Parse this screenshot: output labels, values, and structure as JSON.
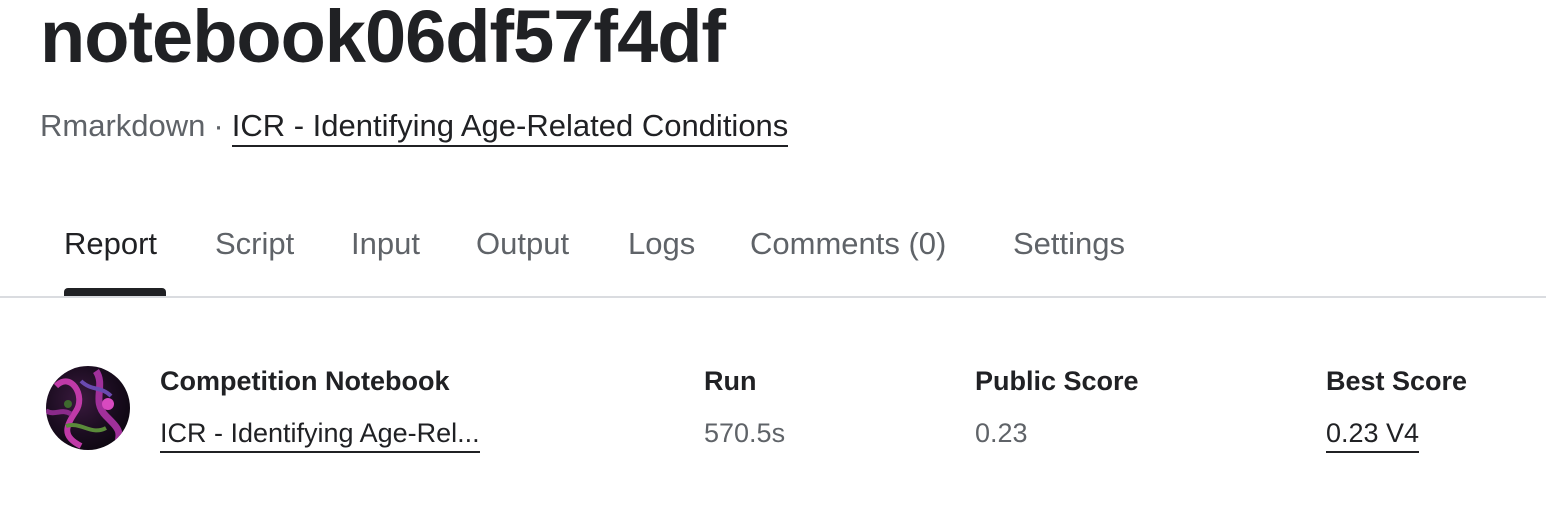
{
  "notebook": {
    "title": "notebook06df57f4df",
    "language": "Rmarkdown",
    "separator": "·",
    "competition_link": "ICR - Identifying Age-Related Conditions"
  },
  "tabs": [
    {
      "label": "Report",
      "active": true
    },
    {
      "label": "Script",
      "active": false
    },
    {
      "label": "Input",
      "active": false
    },
    {
      "label": "Output",
      "active": false
    },
    {
      "label": "Logs",
      "active": false
    },
    {
      "label": "Comments (0)",
      "active": false
    },
    {
      "label": "Settings",
      "active": false
    }
  ],
  "summary": {
    "competition_label": "Competition Notebook",
    "competition_value": "ICR - Identifying Age-Rel...",
    "run_label": "Run",
    "run_value": "570.5s",
    "public_score_label": "Public Score",
    "public_score_value": "0.23",
    "best_score_label": "Best Score",
    "best_score_value": "0.23 V4"
  },
  "colors": {
    "text_primary": "#202124",
    "text_secondary": "#5f6368",
    "divider": "#dadce0"
  },
  "icons": {
    "avatar": "competition-thumbnail"
  }
}
